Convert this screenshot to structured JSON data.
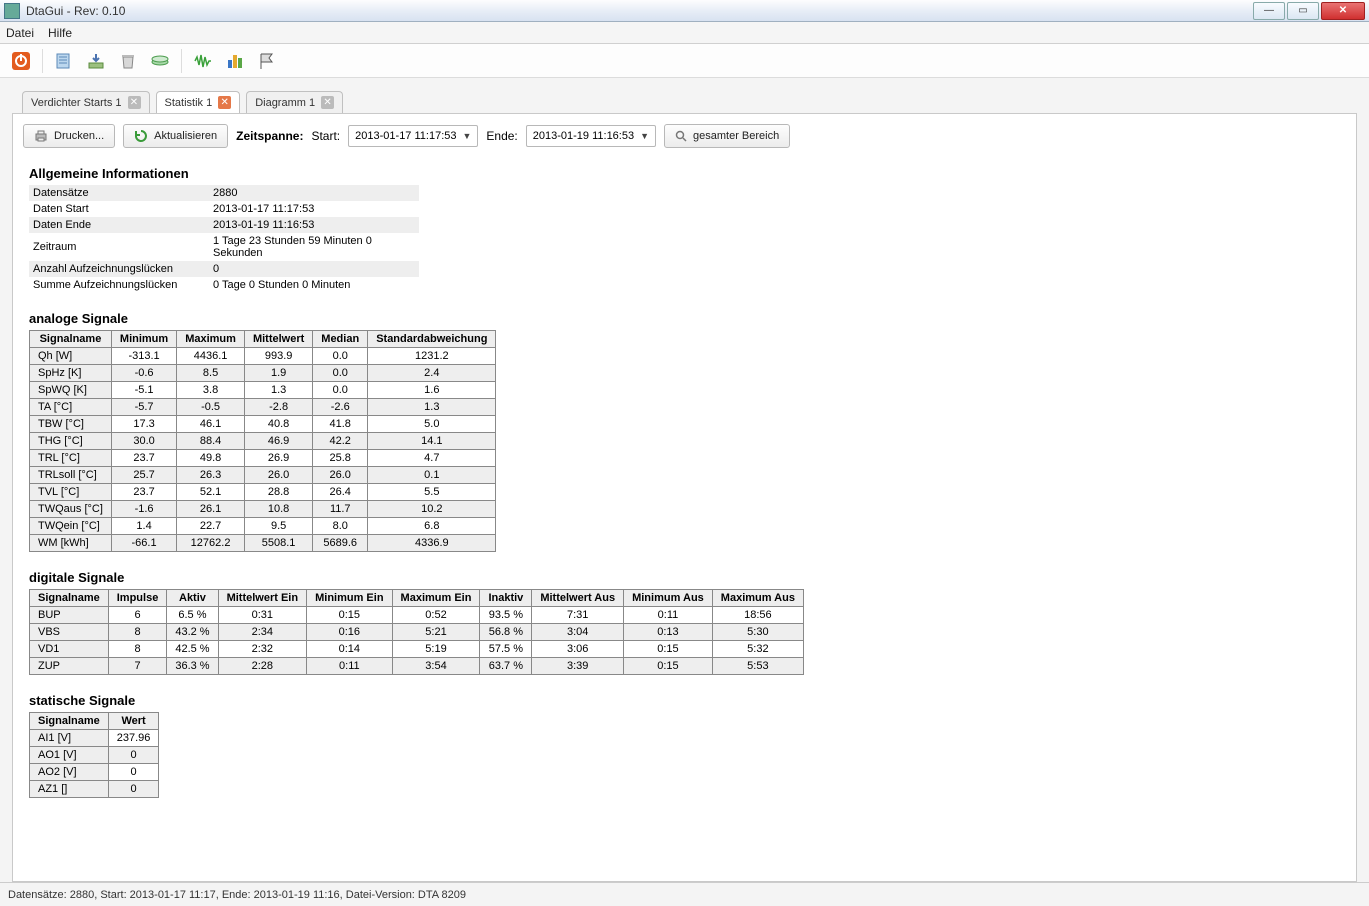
{
  "window": {
    "title": "DtaGui - Rev: 0.10"
  },
  "menubar": {
    "file": "Datei",
    "help": "Hilfe"
  },
  "tabs": [
    {
      "label": "Verdichter Starts 1",
      "active": false
    },
    {
      "label": "Statistik 1",
      "active": true
    },
    {
      "label": "Diagramm 1",
      "active": false
    }
  ],
  "controls": {
    "print": "Drucken...",
    "refresh": "Aktualisieren",
    "timespan_label": "Zeitspanne:",
    "start_label": "Start:",
    "start_value": "2013-01-17 11:17:53",
    "end_label": "Ende:",
    "end_value": "2013-01-19 11:16:53",
    "full_range": "gesamter Bereich"
  },
  "general": {
    "heading": "Allgemeine Informationen",
    "rows": [
      {
        "k": "Datensätze",
        "v": "2880"
      },
      {
        "k": "Daten Start",
        "v": "2013-01-17 11:17:53"
      },
      {
        "k": "Daten Ende",
        "v": "2013-01-19 11:16:53"
      },
      {
        "k": "Zeitraum",
        "v": "1 Tage 23 Stunden 59 Minuten 0 Sekunden"
      },
      {
        "k": "Anzahl Aufzeichnungslücken",
        "v": "0"
      },
      {
        "k": "Summe Aufzeichnungslücken",
        "v": "0 Tage 0 Stunden 0 Minuten"
      }
    ]
  },
  "analog": {
    "heading": "analoge Signale",
    "headers": [
      "Signalname",
      "Minimum",
      "Maximum",
      "Mittelwert",
      "Median",
      "Standardabweichung"
    ],
    "rows": [
      [
        "Qh [W]",
        "-313.1",
        "4436.1",
        "993.9",
        "0.0",
        "1231.2"
      ],
      [
        "SpHz [K]",
        "-0.6",
        "8.5",
        "1.9",
        "0.0",
        "2.4"
      ],
      [
        "SpWQ [K]",
        "-5.1",
        "3.8",
        "1.3",
        "0.0",
        "1.6"
      ],
      [
        "TA [°C]",
        "-5.7",
        "-0.5",
        "-2.8",
        "-2.6",
        "1.3"
      ],
      [
        "TBW [°C]",
        "17.3",
        "46.1",
        "40.8",
        "41.8",
        "5.0"
      ],
      [
        "THG [°C]",
        "30.0",
        "88.4",
        "46.9",
        "42.2",
        "14.1"
      ],
      [
        "TRL [°C]",
        "23.7",
        "49.8",
        "26.9",
        "25.8",
        "4.7"
      ],
      [
        "TRLsoll [°C]",
        "25.7",
        "26.3",
        "26.0",
        "26.0",
        "0.1"
      ],
      [
        "TVL [°C]",
        "23.7",
        "52.1",
        "28.8",
        "26.4",
        "5.5"
      ],
      [
        "TWQaus [°C]",
        "-1.6",
        "26.1",
        "10.8",
        "11.7",
        "10.2"
      ],
      [
        "TWQein [°C]",
        "1.4",
        "22.7",
        "9.5",
        "8.0",
        "6.8"
      ],
      [
        "WM [kWh]",
        "-66.1",
        "12762.2",
        "5508.1",
        "5689.6",
        "4336.9"
      ]
    ]
  },
  "digital": {
    "heading": "digitale Signale",
    "headers": [
      "Signalname",
      "Impulse",
      "Aktiv",
      "Mittelwert Ein",
      "Minimum Ein",
      "Maximum Ein",
      "Inaktiv",
      "Mittelwert Aus",
      "Minimum Aus",
      "Maximum Aus"
    ],
    "rows": [
      [
        "BUP",
        "6",
        "6.5 %",
        "0:31",
        "0:15",
        "0:52",
        "93.5 %",
        "7:31",
        "0:11",
        "18:56"
      ],
      [
        "VBS",
        "8",
        "43.2 %",
        "2:34",
        "0:16",
        "5:21",
        "56.8 %",
        "3:04",
        "0:13",
        "5:30"
      ],
      [
        "VD1",
        "8",
        "42.5 %",
        "2:32",
        "0:14",
        "5:19",
        "57.5 %",
        "3:06",
        "0:15",
        "5:32"
      ],
      [
        "ZUP",
        "7",
        "36.3 %",
        "2:28",
        "0:11",
        "3:54",
        "63.7 %",
        "3:39",
        "0:15",
        "5:53"
      ]
    ]
  },
  "static": {
    "heading": "statische Signale",
    "headers": [
      "Signalname",
      "Wert"
    ],
    "rows": [
      [
        "AI1 [V]",
        "237.96"
      ],
      [
        "AO1 [V]",
        "0"
      ],
      [
        "AO2 [V]",
        "0"
      ],
      [
        "AZ1 []",
        "0"
      ]
    ]
  },
  "status": "Datensätze: 2880, Start: 2013-01-17 11:17, Ende: 2013-01-19 11:16, Datei-Version: DTA 8209"
}
